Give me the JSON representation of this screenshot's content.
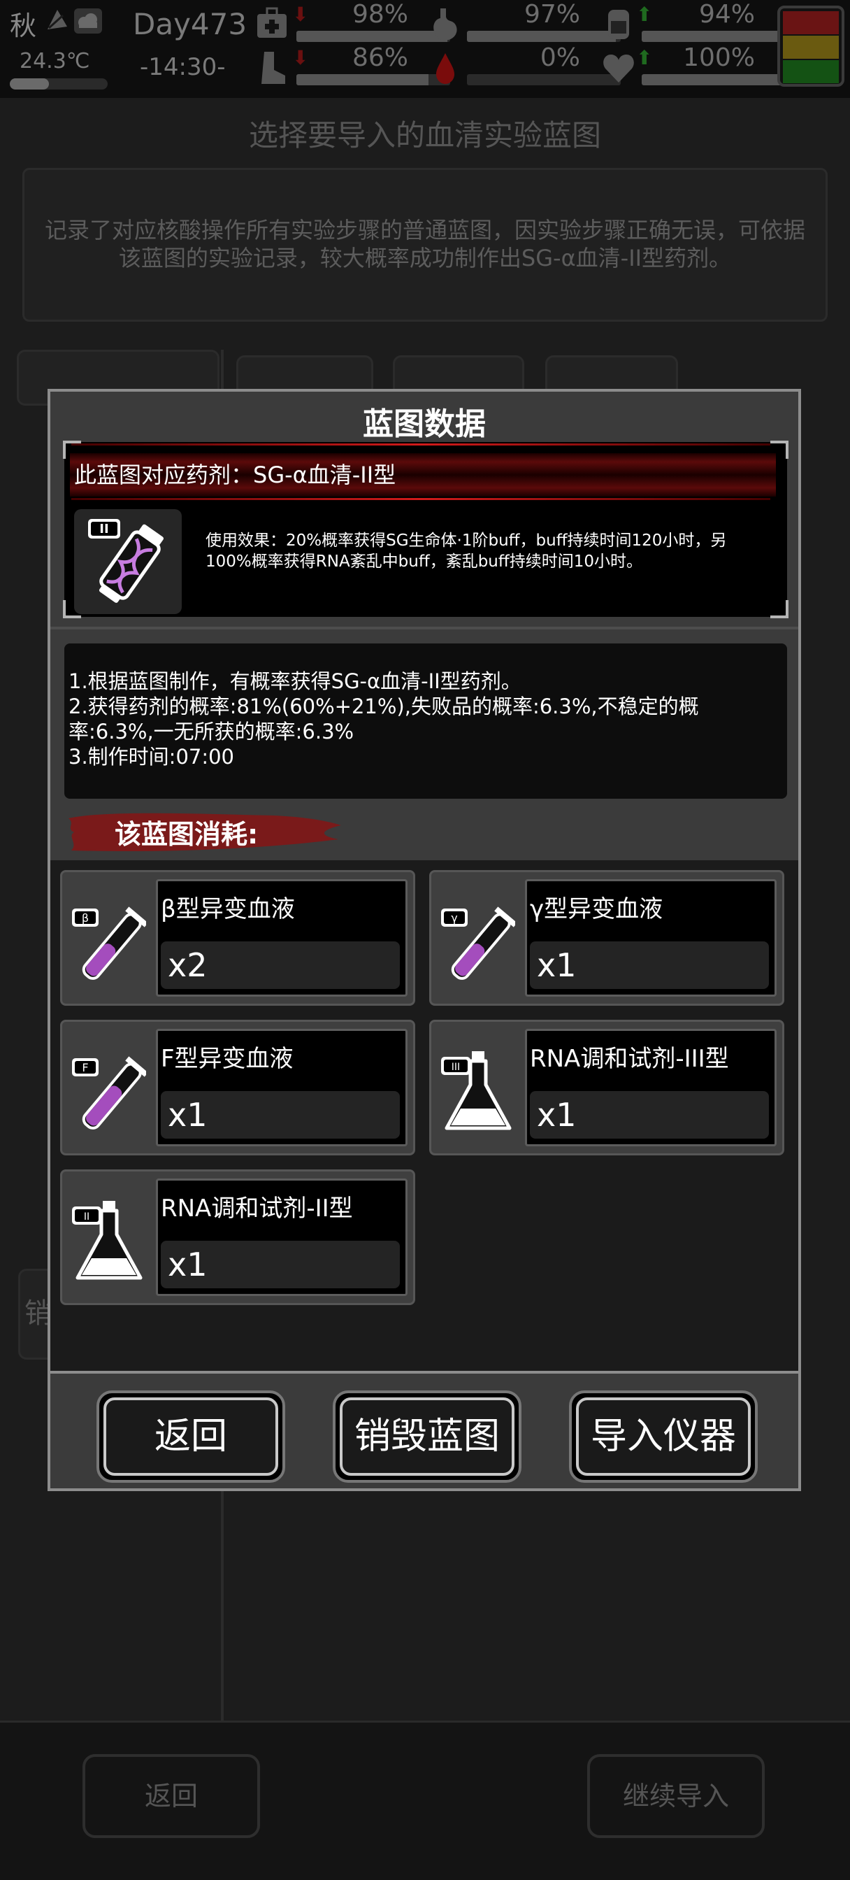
{
  "status": {
    "season": "秋",
    "temperature": "24.3℃",
    "day": "Day473",
    "time": "-14:30-",
    "stats": [
      {
        "icon": "first-aid-kit-icon",
        "value": "98%",
        "fill": 0.98
      },
      {
        "icon": "stomach-icon",
        "value": "97%",
        "fill": 0.97
      },
      {
        "icon": "water-cup-icon",
        "value": "94%",
        "fill": 0.94
      },
      {
        "icon": "boot-icon",
        "value": "86%",
        "fill": 0.86
      },
      {
        "icon": "blood-drop-icon",
        "value": "0%",
        "fill": 0.0
      },
      {
        "icon": "heart-icon",
        "value": "100%",
        "fill": 1.0
      }
    ],
    "danger_colors": [
      "#7a1515",
      "#7a6a10",
      "#155a15"
    ]
  },
  "background": {
    "title": "选择要导入的血清实验蓝图",
    "description": "记录了对应核酸操作所有实验步骤的普通蓝图，因实验步骤正确无误，可依据该蓝图的实验记录，较大概率成功制作出SG-α血清-II型药剂。",
    "back_label": "返回",
    "continue_label": "继续导入",
    "partial_button": "销"
  },
  "modal": {
    "title": "蓝图数据",
    "potion_name": "此蓝图对应药剂：SG-α血清-II型",
    "potion_badge": "II",
    "effect": "使用效果：20%概率获得SG生命体·1阶buff，buff持续时间120小时，另100%概率获得RNA紊乱中buff，紊乱buff持续时间10小时。",
    "info_lines": [
      "1.根据蓝图制作，有概率获得SG-α血清-II型药剂。",
      "2.获得药剂的概率:81%(60%+21%),失败品的概率:6.3%,不稳定的概率:6.3%,一无所获的概率:6.3%",
      "3.制作时间:07:00"
    ],
    "consumption_title": "该蓝图消耗:",
    "items": [
      {
        "name": "β型异变血液",
        "qty": "x2",
        "badge": "β",
        "kind": "tube"
      },
      {
        "name": "γ型异变血液",
        "qty": "x1",
        "badge": "γ",
        "kind": "tube"
      },
      {
        "name": "F型异变血液",
        "qty": "x1",
        "badge": "F",
        "kind": "tube"
      },
      {
        "name": "RNA调和试剂-III型",
        "qty": "x1",
        "badge": "III",
        "kind": "flask"
      },
      {
        "name": "RNA调和试剂-II型",
        "qty": "x1",
        "badge": "II",
        "kind": "flask"
      }
    ],
    "buttons": {
      "back": "返回",
      "destroy": "销毁蓝图",
      "import": "导入仪器"
    }
  }
}
